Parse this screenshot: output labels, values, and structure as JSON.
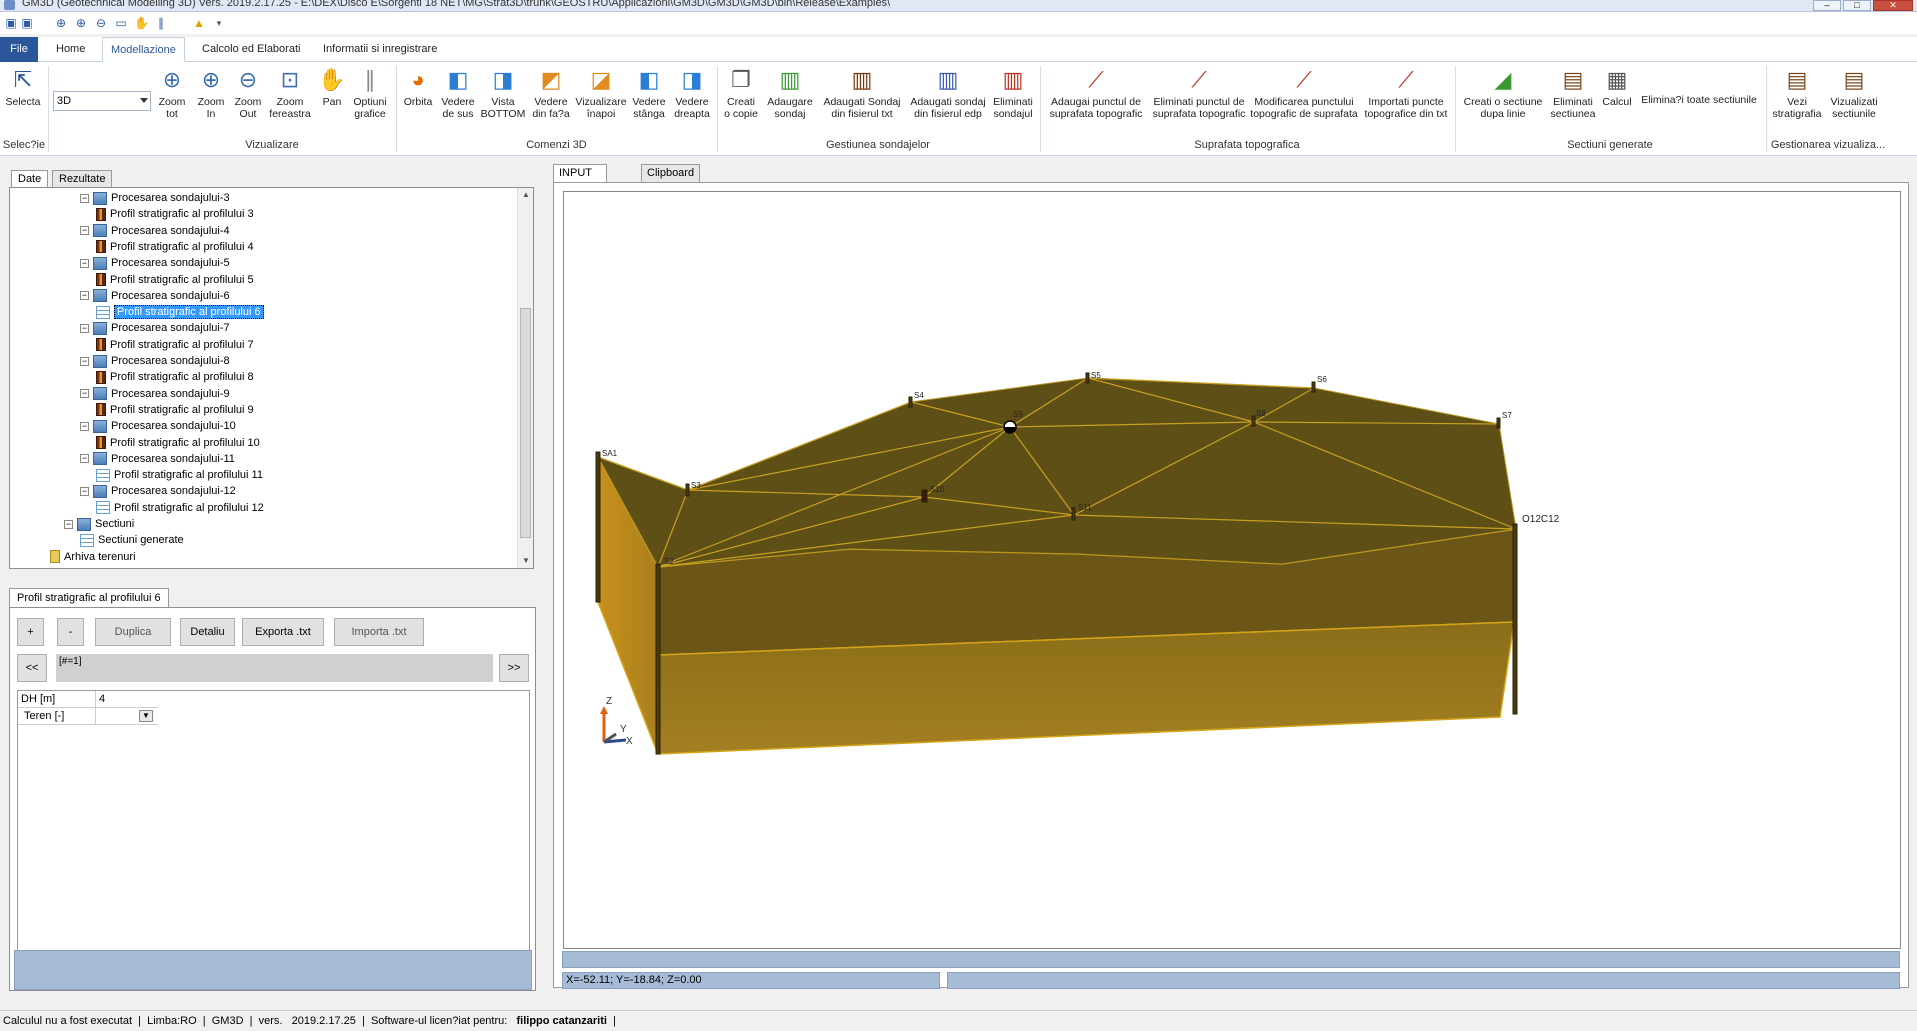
{
  "window": {
    "title": "GM3D (Geotechnical Modelling 3D) Vers. 2019.2.17.25 - E:\\DEX\\Disco E\\Sorgenti 18 NET\\MG\\Strat3D\\trunk\\GEOSTRU\\Applicazioni\\GM3D\\GM3D\\GM3D\\bin\\Release\\Examples\\",
    "minimize": "–",
    "maximize": "□",
    "close": "✕"
  },
  "ribbon_tabs": [
    "File",
    "Home",
    "Modellazione",
    "Calcolo ed Elaborati",
    "Informatii si inregistrare"
  ],
  "ribbon": {
    "view_combo": "3D",
    "selecta": "Selecta",
    "groups": {
      "selectie": "Selec?ie",
      "vizualizare": "Vizualizare",
      "comenzi3d": "Comenzi 3D",
      "sondaje": "Gestiunea sondajelor",
      "topo": "Suprafata topografica",
      "sectiuni": "Sectiuni generate",
      "viz": "Gestionarea vizualiza..."
    },
    "buttons": {
      "zoom_tot": [
        "Zoom",
        "tot"
      ],
      "zoom_in": [
        "Zoom",
        "In"
      ],
      "zoom_out": [
        "Zoom",
        "Out"
      ],
      "zoom_fereastra": [
        "Zoom",
        "fereastra"
      ],
      "pan": [
        "Pan",
        ""
      ],
      "optiuni_grafice": [
        "Optiuni",
        "grafice"
      ],
      "orbita": [
        "Orbita",
        ""
      ],
      "vedere_sus": [
        "Vedere",
        "de sus"
      ],
      "vista_bottom": [
        "Vista",
        "BOTTOM"
      ],
      "vedere_fata": [
        "Vedere",
        "din fa?a"
      ],
      "viz_inapoi": [
        "Vizualizare",
        "înapoi"
      ],
      "vedere_stanga": [
        "Vedere",
        "stânga"
      ],
      "vedere_dreapta": [
        "Vedere",
        "dreapta"
      ],
      "creati_copie": [
        "Creati",
        "o copie"
      ],
      "adaugare_sondaj": [
        "Adaugare",
        "sondaj"
      ],
      "adaugati_txt": [
        "Adaugati Sondaj",
        "din fisierul txt"
      ],
      "adaugati_edp": [
        "Adaugati sondaj",
        "din fisierul edp"
      ],
      "eliminati_sondajul": [
        "Eliminati",
        "sondajul"
      ],
      "adaugai_punct": [
        "Adaugai punctul de",
        "suprafata topografic"
      ],
      "eliminati_punct": [
        "Eliminati punctul de",
        "suprafata topografic"
      ],
      "modificarea_punct": [
        "Modificarea punctului",
        "topografic de suprafata"
      ],
      "importati_puncte": [
        "Importati puncte",
        "topografice din txt"
      ],
      "creati_sectiune": [
        "Creati o sectiune",
        "dupa linie"
      ],
      "eliminati_sectiunea": [
        "Eliminati",
        "sectiunea"
      ],
      "calcul": [
        "Calcul",
        ""
      ],
      "eliminati_toate": [
        "Elimina?i toate sectiunile",
        ""
      ],
      "vezi_stratigrafia": [
        "Vezi",
        "stratigrafia"
      ],
      "vizualizati_sectiunile": [
        "Vizualizati",
        "sectiunile"
      ]
    }
  },
  "left_tabs": [
    "Date",
    "Rezultate"
  ],
  "tree": [
    {
      "label": "Procesarea sondajului-3",
      "level": 0,
      "icon": "proc"
    },
    {
      "label": "Profil stratigrafic al profilului 3",
      "level": 1,
      "icon": "prof"
    },
    {
      "label": "Procesarea sondajului-4",
      "level": 0,
      "icon": "proc"
    },
    {
      "label": "Profil stratigrafic al profilului 4",
      "level": 1,
      "icon": "prof"
    },
    {
      "label": "Procesarea sondajului-5",
      "level": 0,
      "icon": "proc"
    },
    {
      "label": "Profil stratigrafic al profilului 5",
      "level": 1,
      "icon": "prof"
    },
    {
      "label": "Procesarea sondajului-6",
      "level": 0,
      "icon": "proc"
    },
    {
      "label": "Profil stratigrafic al profilului 6",
      "level": 1,
      "icon": "grid",
      "selected": true
    },
    {
      "label": "Procesarea sondajului-7",
      "level": 0,
      "icon": "proc"
    },
    {
      "label": "Profil stratigrafic al profilului 7",
      "level": 1,
      "icon": "prof"
    },
    {
      "label": "Procesarea sondajului-8",
      "level": 0,
      "icon": "proc"
    },
    {
      "label": "Profil stratigrafic al profilului 8",
      "level": 1,
      "icon": "prof"
    },
    {
      "label": "Procesarea sondajului-9",
      "level": 0,
      "icon": "proc"
    },
    {
      "label": "Profil stratigrafic al profilului 9",
      "level": 1,
      "icon": "prof"
    },
    {
      "label": "Procesarea sondajului-10",
      "level": 0,
      "icon": "proc"
    },
    {
      "label": "Profil stratigrafic al profilului 10",
      "level": 1,
      "icon": "prof"
    },
    {
      "label": "Procesarea sondajului-11",
      "level": 0,
      "icon": "proc"
    },
    {
      "label": "Profil stratigrafic al profilului 11",
      "level": 1,
      "icon": "grid"
    },
    {
      "label": "Procesarea sondajului-12",
      "level": 0,
      "icon": "proc"
    },
    {
      "label": "Profil stratigrafic al profilului 12",
      "level": 1,
      "icon": "grid"
    },
    {
      "label": "Sectiuni",
      "level": -1,
      "icon": "proc"
    },
    {
      "label": "Sectiuni generate",
      "level": 0,
      "icon": "grid"
    },
    {
      "label": "Arhiva terenuri",
      "level": -2,
      "icon": "folder"
    }
  ],
  "panel": {
    "tab": "Profil stratigrafic al profilului 6",
    "plus": "+",
    "minus": "-",
    "duplica": "Duplica",
    "detaliu": "Detaliu",
    "exporta": "Exporta .txt",
    "importa": "Importa .txt",
    "prev": "<<",
    "next": ">>",
    "record": "[#=1]",
    "rows": [
      {
        "key": "DH [m]",
        "value": "4"
      },
      {
        "key": "Teren [-]",
        "value": ""
      }
    ]
  },
  "viewport_tabs": [
    "INPUT GRAFIC",
    "Clipboard"
  ],
  "viewport": {
    "point_labels": [
      "SA1",
      "S2",
      "S3",
      "S4",
      "S5",
      "S6",
      "S7",
      "S8",
      "S9",
      "S10",
      "S11",
      "O12C12"
    ],
    "axis": {
      "z": "Z",
      "y": "Y",
      "x": "X"
    },
    "coords": "X=-52.11; Y=-18.84; Z=0.00"
  },
  "statusbar": {
    "calc": "Calculul nu a fost executat",
    "limba": "Limba:RO",
    "app": "GM3D",
    "vers_label": "vers.",
    "vers": "2019.2.17.25",
    "licensed": "Software-ul licen?iat pentru:",
    "user": "filippo catanzariti"
  },
  "colors": {
    "ribbon_blue": "#2b579a",
    "terrain_top": "#6b5a1a",
    "terrain_side": "#9a7a20",
    "terrain_edge": "#c8a020",
    "status_panel": "#a6bcd6"
  }
}
